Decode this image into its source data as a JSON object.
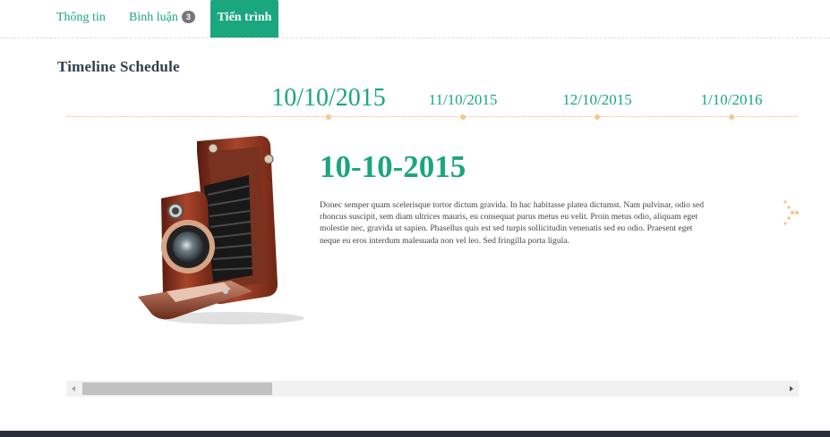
{
  "tabs": [
    {
      "label": "Thông tin"
    },
    {
      "label": "Bình luận",
      "badge": "3"
    },
    {
      "label": "Tiến trình",
      "active": true
    }
  ],
  "section_title": "Timeline Schedule",
  "timeline": {
    "dates": [
      "10/10/2015",
      "11/10/2015",
      "12/10/2015",
      "1/10/2016"
    ],
    "selected_index": 0
  },
  "event": {
    "title": "10-10-2015",
    "body": "Donec semper quam scelerisque tortor dictum gravida. In hac habitasse platea dictumst. Nam pulvinar, odio sed rhoncus suscipit, sem diam ultrices mauris, eu consequat purus metus eu velit. Proin metus odio, aliquam eget molestie nec, gravida ut sapien. Phasellus quis est sed turpis sollicitudin venenatis sed eu odio. Praesent eget neque eu eros interdum malesuada non vel leo. Sed fringilla porta ligula.",
    "image_icon": "vintage-camera-icon"
  },
  "icons": {
    "next": "next-arrow-icon"
  },
  "colors": {
    "accent": "#1aa67f",
    "timeline_dot": "#f6c68b",
    "title": "#2f3f4f",
    "footer": "#2b2b3a"
  }
}
